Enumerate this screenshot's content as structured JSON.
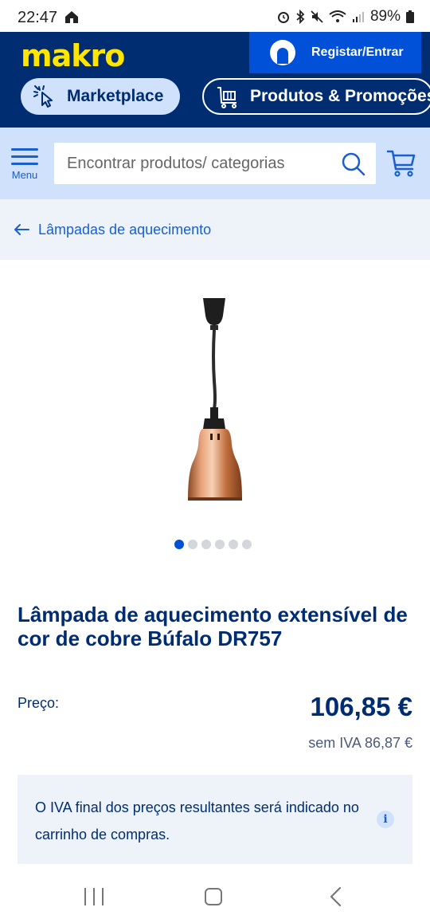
{
  "status_bar": {
    "time": "22:47",
    "battery": "89%",
    "icons": [
      "home-icon",
      "alarm-icon",
      "bluetooth-icon",
      "mute-icon",
      "wifi-icon",
      "signal-icon",
      "battery-icon"
    ]
  },
  "header": {
    "logo": "makro",
    "login_label": "Registar/Entrar",
    "marketplace_label": "Marketplace",
    "produtos_label": "Produtos & Promoções"
  },
  "search": {
    "menu_label": "Menu",
    "placeholder": "Encontrar produtos/ categorias"
  },
  "breadcrumb": {
    "label": "Lâmpadas de aquecimento"
  },
  "product": {
    "title": "Lâmpada de aquecimento extensível de cor de cobre Búfalo DR757",
    "carousel": {
      "total": 6,
      "active": 1
    },
    "price_label": "Preço:",
    "price": "106,85 €",
    "price_no_vat": "sem IVA 86,87 €"
  },
  "vat_notice": {
    "text": "O IVA final dos preços resultantes será indicado no carrinho de compras.",
    "icon": "i"
  },
  "colors": {
    "brand_dark": "#002d72",
    "brand_yellow": "#ffe500",
    "accent_blue": "#0050d8",
    "light_blue": "#cfe1fb"
  }
}
